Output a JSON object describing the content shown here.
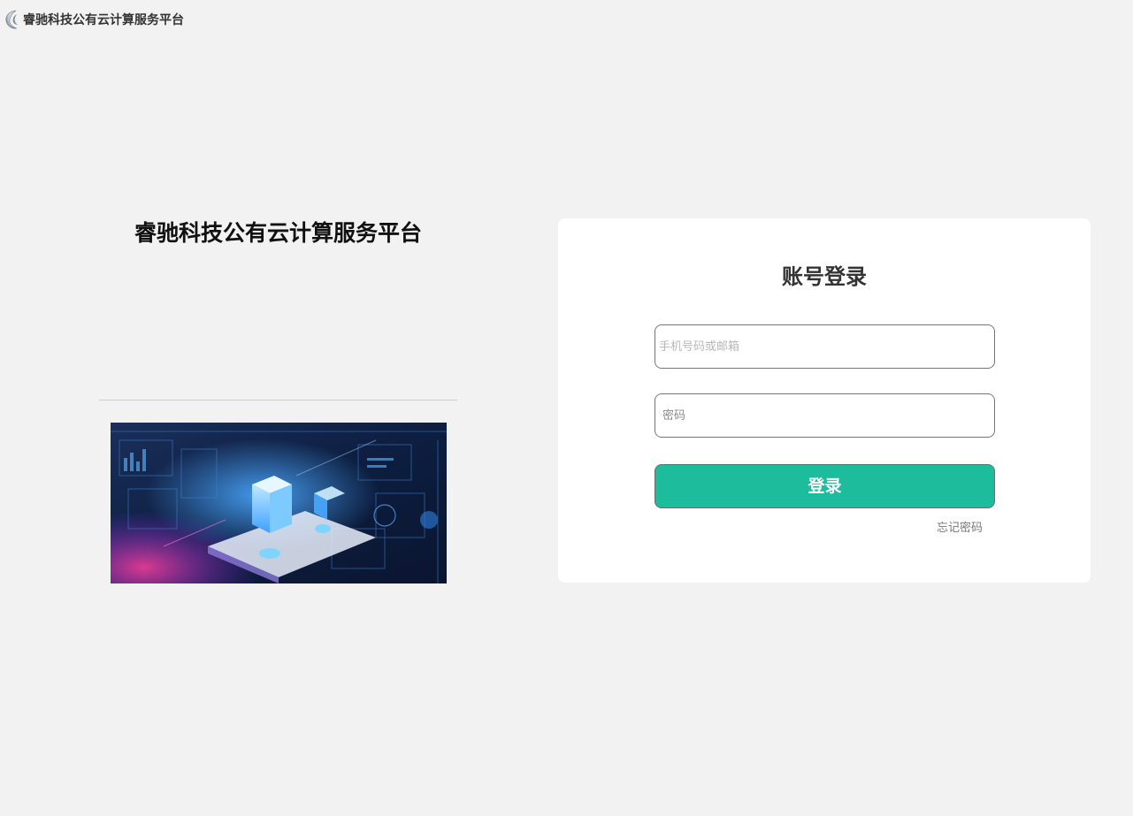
{
  "header": {
    "brand_name": "睿驰科技公有云计算服务平台",
    "logo_icon": "logo-icon"
  },
  "left_panel": {
    "title": "睿驰科技公有云计算服务平台",
    "hero_image": "cloud-datacenter-illustration"
  },
  "login": {
    "title": "账号登录",
    "username": {
      "value": "",
      "placeholder": "手机号码或邮箱"
    },
    "password": {
      "value": "",
      "placeholder": "密码"
    },
    "submit_label": "登录",
    "forgot_label": "忘记密码"
  },
  "colors": {
    "page_bg": "#f2f2f2",
    "card_bg": "#ffffff",
    "accent": "#1cbc9c"
  }
}
